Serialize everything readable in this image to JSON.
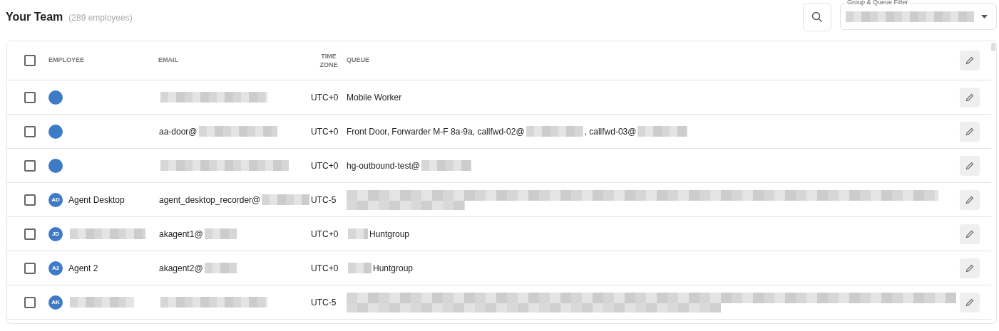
{
  "header": {
    "title": "Your Team",
    "count": "(289 employees)"
  },
  "filter": {
    "label": "Group & Queue Filter",
    "value": [
      {
        "kind": "redacted"
      }
    ]
  },
  "table": {
    "columns": [
      "EMPLOYEE",
      "EMAIL",
      "TIME ZONE",
      "QUEUE"
    ],
    "select_all": {
      "checked": false
    },
    "rows": [
      {
        "checked": false,
        "initials": "",
        "name": [],
        "email": [
          {
            "kind": "redacted"
          }
        ],
        "time_zone": "UTC+0",
        "queue": [
          {
            "kind": "text",
            "text": "Mobile Worker"
          }
        ]
      },
      {
        "checked": false,
        "initials": "",
        "name": [],
        "email": [
          {
            "kind": "text",
            "text": "aa-door@"
          },
          {
            "kind": "redacted"
          }
        ],
        "time_zone": "UTC+0",
        "queue": [
          {
            "kind": "text",
            "text": "Front Door, Forwarder M-F 8a-9a, callfwd-02@"
          },
          {
            "kind": "redacted"
          },
          {
            "kind": "text",
            "text": ", callfwd-03@"
          },
          {
            "kind": "redacted"
          }
        ]
      },
      {
        "checked": false,
        "initials": "",
        "name": [],
        "email": [
          {
            "kind": "redacted"
          }
        ],
        "time_zone": "UTC+0",
        "queue": [
          {
            "kind": "text",
            "text": "hg-outbound-test@"
          },
          {
            "kind": "redacted"
          }
        ]
      },
      {
        "checked": false,
        "initials": "AD",
        "name": [
          {
            "kind": "text",
            "text": "Agent Desktop"
          }
        ],
        "email": [
          {
            "kind": "text",
            "text": "agent_desktop_recorder@"
          },
          {
            "kind": "redacted"
          }
        ],
        "time_zone": "UTC-5",
        "queue": [
          {
            "kind": "redacted_wrap"
          }
        ]
      },
      {
        "checked": false,
        "initials": "JD",
        "name": [
          {
            "kind": "redacted"
          }
        ],
        "email": [
          {
            "kind": "text",
            "text": "akagent1@"
          },
          {
            "kind": "redacted"
          }
        ],
        "time_zone": "UTC+0",
        "queue": [
          {
            "kind": "redacted"
          },
          {
            "kind": "text",
            "text": "Huntgroup"
          }
        ]
      },
      {
        "checked": false,
        "initials": "A2",
        "name": [
          {
            "kind": "text",
            "text": "Agent 2"
          }
        ],
        "email": [
          {
            "kind": "text",
            "text": "akagent2@"
          },
          {
            "kind": "redacted"
          }
        ],
        "time_zone": "UTC+0",
        "queue": [
          {
            "kind": "redacted"
          },
          {
            "kind": "text",
            "text": "Huntgroup"
          }
        ]
      },
      {
        "checked": false,
        "initials": "AK",
        "name": [
          {
            "kind": "redacted"
          }
        ],
        "email": [
          {
            "kind": "redacted"
          }
        ],
        "time_zone": "UTC-5",
        "queue": [
          {
            "kind": "redacted_wrap"
          }
        ]
      }
    ]
  }
}
